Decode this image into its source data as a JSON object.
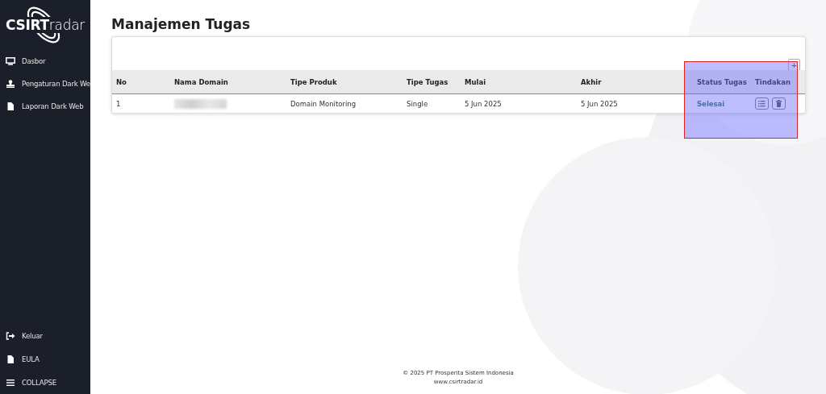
{
  "sidebar": {
    "logo": "**CSIRT**radar",
    "items": [
      {
        "label": "Dasbor",
        "kind": "monitor"
      },
      {
        "label": "Pengaturan Dark We",
        "kind": "user"
      },
      {
        "label": "Laporan Dark Web",
        "kind": "file"
      }
    ],
    "bottom_items": [
      {
        "label": "Keluar",
        "kind": "logout"
      },
      {
        "label": "EULA",
        "kind": "file"
      },
      {
        "label": "COLLAPSE",
        "kind": "menu"
      }
    ]
  },
  "page": {
    "title": "Manajemen Tugas",
    "add_button": "+"
  },
  "table": {
    "columns": [
      "No",
      "Nama Domain",
      "Tipe Produk",
      "Tipe Tugas",
      "Mulai",
      "Akhir",
      "Status Tugas",
      "Tindakan"
    ],
    "rows": [
      {
        "no": "1",
        "domain_blurred": true,
        "product": "Domain Monitoring",
        "task_type": "Single",
        "start": "5 Jun 2025",
        "end": "5 Jun 2025",
        "status": "Selesai"
      }
    ]
  },
  "footer": {
    "copyright": "© 2025 PT Prosperita Sistem Indonesia",
    "website": "www.csirtradar.id"
  }
}
